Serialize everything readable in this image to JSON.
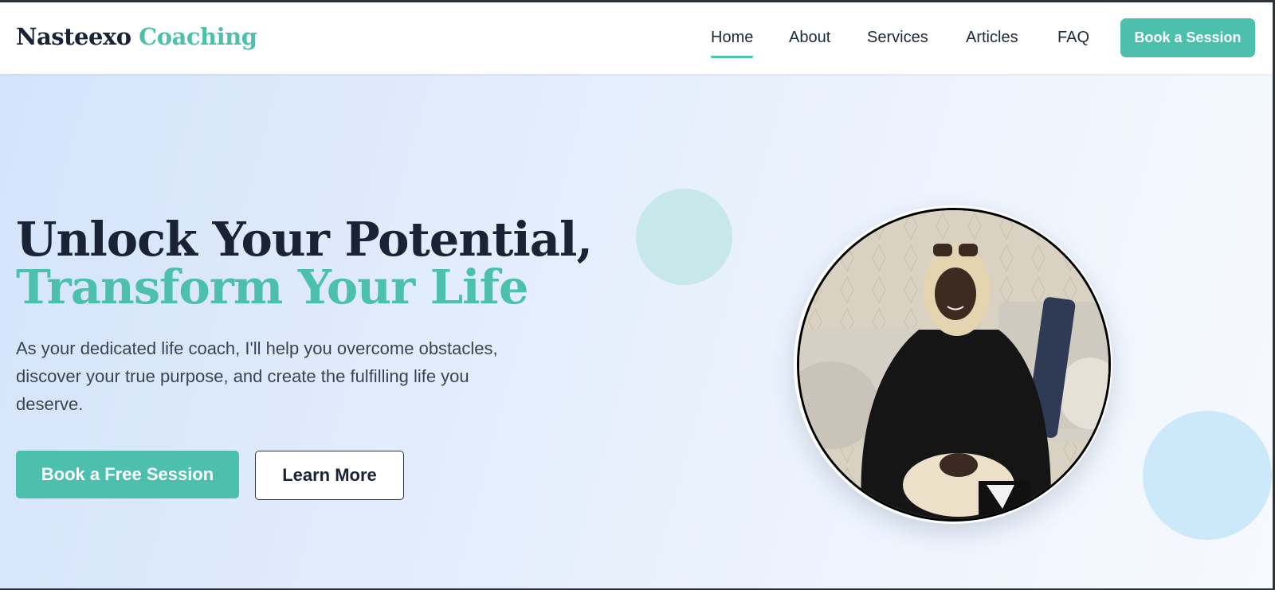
{
  "brand": {
    "name_part1": "Nasteexo",
    "name_part2": "Coaching"
  },
  "nav": {
    "items": [
      {
        "label": "Home",
        "active": true
      },
      {
        "label": "About",
        "active": false
      },
      {
        "label": "Services",
        "active": false
      },
      {
        "label": "Articles",
        "active": false
      },
      {
        "label": "FAQ",
        "active": false
      }
    ],
    "cta_label": "Book a Session"
  },
  "hero": {
    "title_line1": "Unlock Your Potential,",
    "title_line2": "Transform Your Life",
    "description": "As your dedicated life coach, I'll help you overcome obstacles, discover your true purpose, and create the fulfilling life you deserve.",
    "primary_button": "Book a Free Session",
    "secondary_button": "Learn More"
  },
  "colors": {
    "accent": "#4cc0ad",
    "dark_text": "#1a2236",
    "hero_background": "#dfeafc"
  }
}
